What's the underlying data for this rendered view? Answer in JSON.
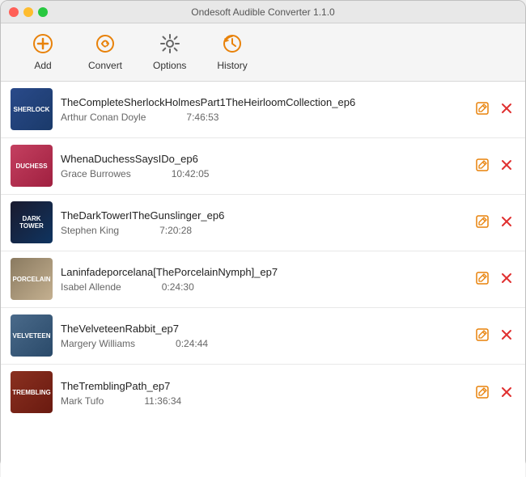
{
  "titleBar": {
    "title": "Ondesoft Audible Converter 1.1.0"
  },
  "toolbar": {
    "buttons": [
      {
        "id": "add",
        "label": "Add",
        "iconType": "add"
      },
      {
        "id": "convert",
        "label": "Convert",
        "iconType": "convert"
      },
      {
        "id": "options",
        "label": "Options",
        "iconType": "options"
      },
      {
        "id": "history",
        "label": "History",
        "iconType": "history"
      }
    ]
  },
  "books": [
    {
      "id": "book1",
      "title": "TheCompleteSherlockHolmesPart1TheHeirloomCollection_ep6",
      "author": "Arthur Conan Doyle",
      "duration": "7:46:53",
      "coverClass": "cover-sherlock",
      "coverText": "SHERLOCK"
    },
    {
      "id": "book2",
      "title": "WhenaDuchessSaysIDo_ep6",
      "author": "Grace Burrowes",
      "duration": "10:42:05",
      "coverClass": "cover-duchess",
      "coverText": "DUCHESS"
    },
    {
      "id": "book3",
      "title": "TheDarkTowerITheGunslinger_ep6",
      "author": "Stephen King",
      "duration": "7:20:28",
      "coverClass": "cover-darktower",
      "coverText": "DARK TOWER"
    },
    {
      "id": "book4",
      "title": "Laninfadeporcelana[ThePorcelainNymph]_ep7",
      "author": "Isabel Allende",
      "duration": "0:24:30",
      "coverClass": "cover-porcelain",
      "coverText": "PORCELAIN"
    },
    {
      "id": "book5",
      "title": "TheVelveteenRabbit_ep7",
      "author": "Margery Williams",
      "duration": "0:24:44",
      "coverClass": "cover-velveteen",
      "coverText": "VELVETEEN"
    },
    {
      "id": "book6",
      "title": "TheTremblingPath_ep7",
      "author": "Mark Tufo",
      "duration": "11:36:34",
      "coverClass": "cover-trembling",
      "coverText": "TREMBLING"
    }
  ],
  "actions": {
    "edit": "✎",
    "delete": "✕"
  }
}
